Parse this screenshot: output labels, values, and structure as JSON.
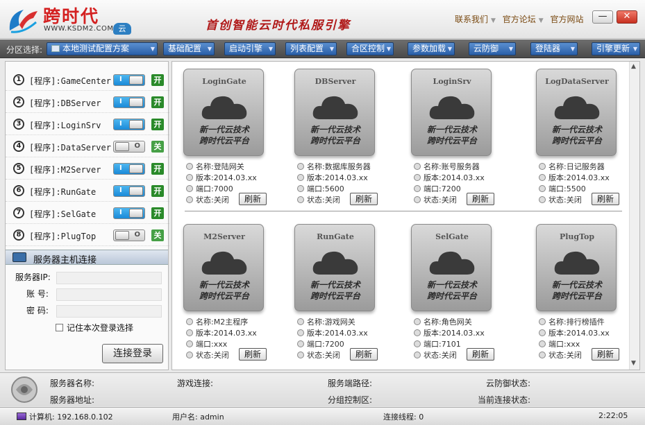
{
  "header": {
    "logo_text": "跨时代",
    "logo_url": "WWW.KSDM2.COM",
    "logo_badge": "云",
    "slogan": "首创智能云时代私服引擎",
    "links": [
      "联系我们",
      "官方论坛",
      "官方网站"
    ],
    "minimize": "—",
    "close": "✕"
  },
  "toolbar": {
    "zone_label": "分区选择:",
    "zone_value": "本地测试配置方案",
    "menus": [
      "基础配置",
      "启动引擎",
      "列表配置",
      "合区控制",
      "参数加载",
      "云防御",
      "登陆器",
      "引擎更新"
    ]
  },
  "programs": [
    {
      "num": "1",
      "label": "[程序]:GameCenter",
      "state": "on",
      "status": "开"
    },
    {
      "num": "2",
      "label": "[程序]:DBServer",
      "state": "on",
      "status": "开"
    },
    {
      "num": "3",
      "label": "[程序]:LoginSrv",
      "state": "on",
      "status": "开"
    },
    {
      "num": "4",
      "label": "[程序]:DataServer",
      "state": "off",
      "status": "关"
    },
    {
      "num": "5",
      "label": "[程序]:M2Server",
      "state": "on",
      "status": "开"
    },
    {
      "num": "6",
      "label": "[程序]:RunGate",
      "state": "on",
      "status": "开"
    },
    {
      "num": "7",
      "label": "[程序]:SelGate",
      "state": "on",
      "status": "开"
    },
    {
      "num": "8",
      "label": "[程序]:PlugTop",
      "state": "off",
      "status": "关"
    }
  ],
  "toggle_on_mark": "I",
  "toggle_off_mark": "O",
  "connection": {
    "title": "服务器主机连接",
    "ip_label": "服务器IP:",
    "ip_value": "",
    "account_label": "账  号:",
    "account_value": "",
    "password_label": "密  码:",
    "password_value": "",
    "remember_label": "记住本次登录选择",
    "login_button": "连接登录"
  },
  "disk_line1": "新一代云技术",
  "disk_line2": "跨时代云平台",
  "refresh_label": "刷新",
  "servers": [
    {
      "disk_name": "LoginGate",
      "name": "名称:登陆网关",
      "version": "版本:2014.03.xx",
      "port": "端口:7000",
      "status": "状态:关闭"
    },
    {
      "disk_name": "DBServer",
      "name": "名称:数据库服务器",
      "version": "版本:2014.03.xx",
      "port": "端口:5600",
      "status": "状态:关闭"
    },
    {
      "disk_name": "LoginSrv",
      "name": "名称:账号服务器",
      "version": "版本:2014.03.xx",
      "port": "端口:7200",
      "status": "状态:关闭"
    },
    {
      "disk_name": "LogDataServer",
      "name": "名称:日记服务器",
      "version": "版本:2014.03.xx",
      "port": "端口:5500",
      "status": "状态:关闭"
    },
    {
      "disk_name": "M2Server",
      "name": "名称:M2主程序",
      "version": "版本:2014.03.xx",
      "port": "端口:xxx",
      "status": "状态:关闭"
    },
    {
      "disk_name": "RunGate",
      "name": "名称:游戏网关",
      "version": "版本:2014.03.xx",
      "port": "端口:7200",
      "status": "状态:关闭"
    },
    {
      "disk_name": "SelGate",
      "name": "名称:角色网关",
      "version": "版本:2014.03.xx",
      "port": "端口:7101",
      "status": "状态:关闭"
    },
    {
      "disk_name": "PlugTop",
      "name": "名称:排行榜插件",
      "version": "版本:2014.03.xx",
      "port": "端口:xxx",
      "status": "状态:关闭"
    }
  ],
  "bottom": {
    "server_name": "服务器名称:",
    "game_conn": "游戏连接:",
    "server_path": "服务端路径:",
    "cloud_status": "云防御状态:",
    "server_addr": "服务器地址:",
    "group_ctrl": "分组控制区:",
    "current_conn": "当前连接状态:"
  },
  "statusbar": {
    "computer": "计算机: 192.168.0.102",
    "user": "用户名: admin",
    "threads": "连接线程: 0",
    "time": "2:22:05"
  }
}
